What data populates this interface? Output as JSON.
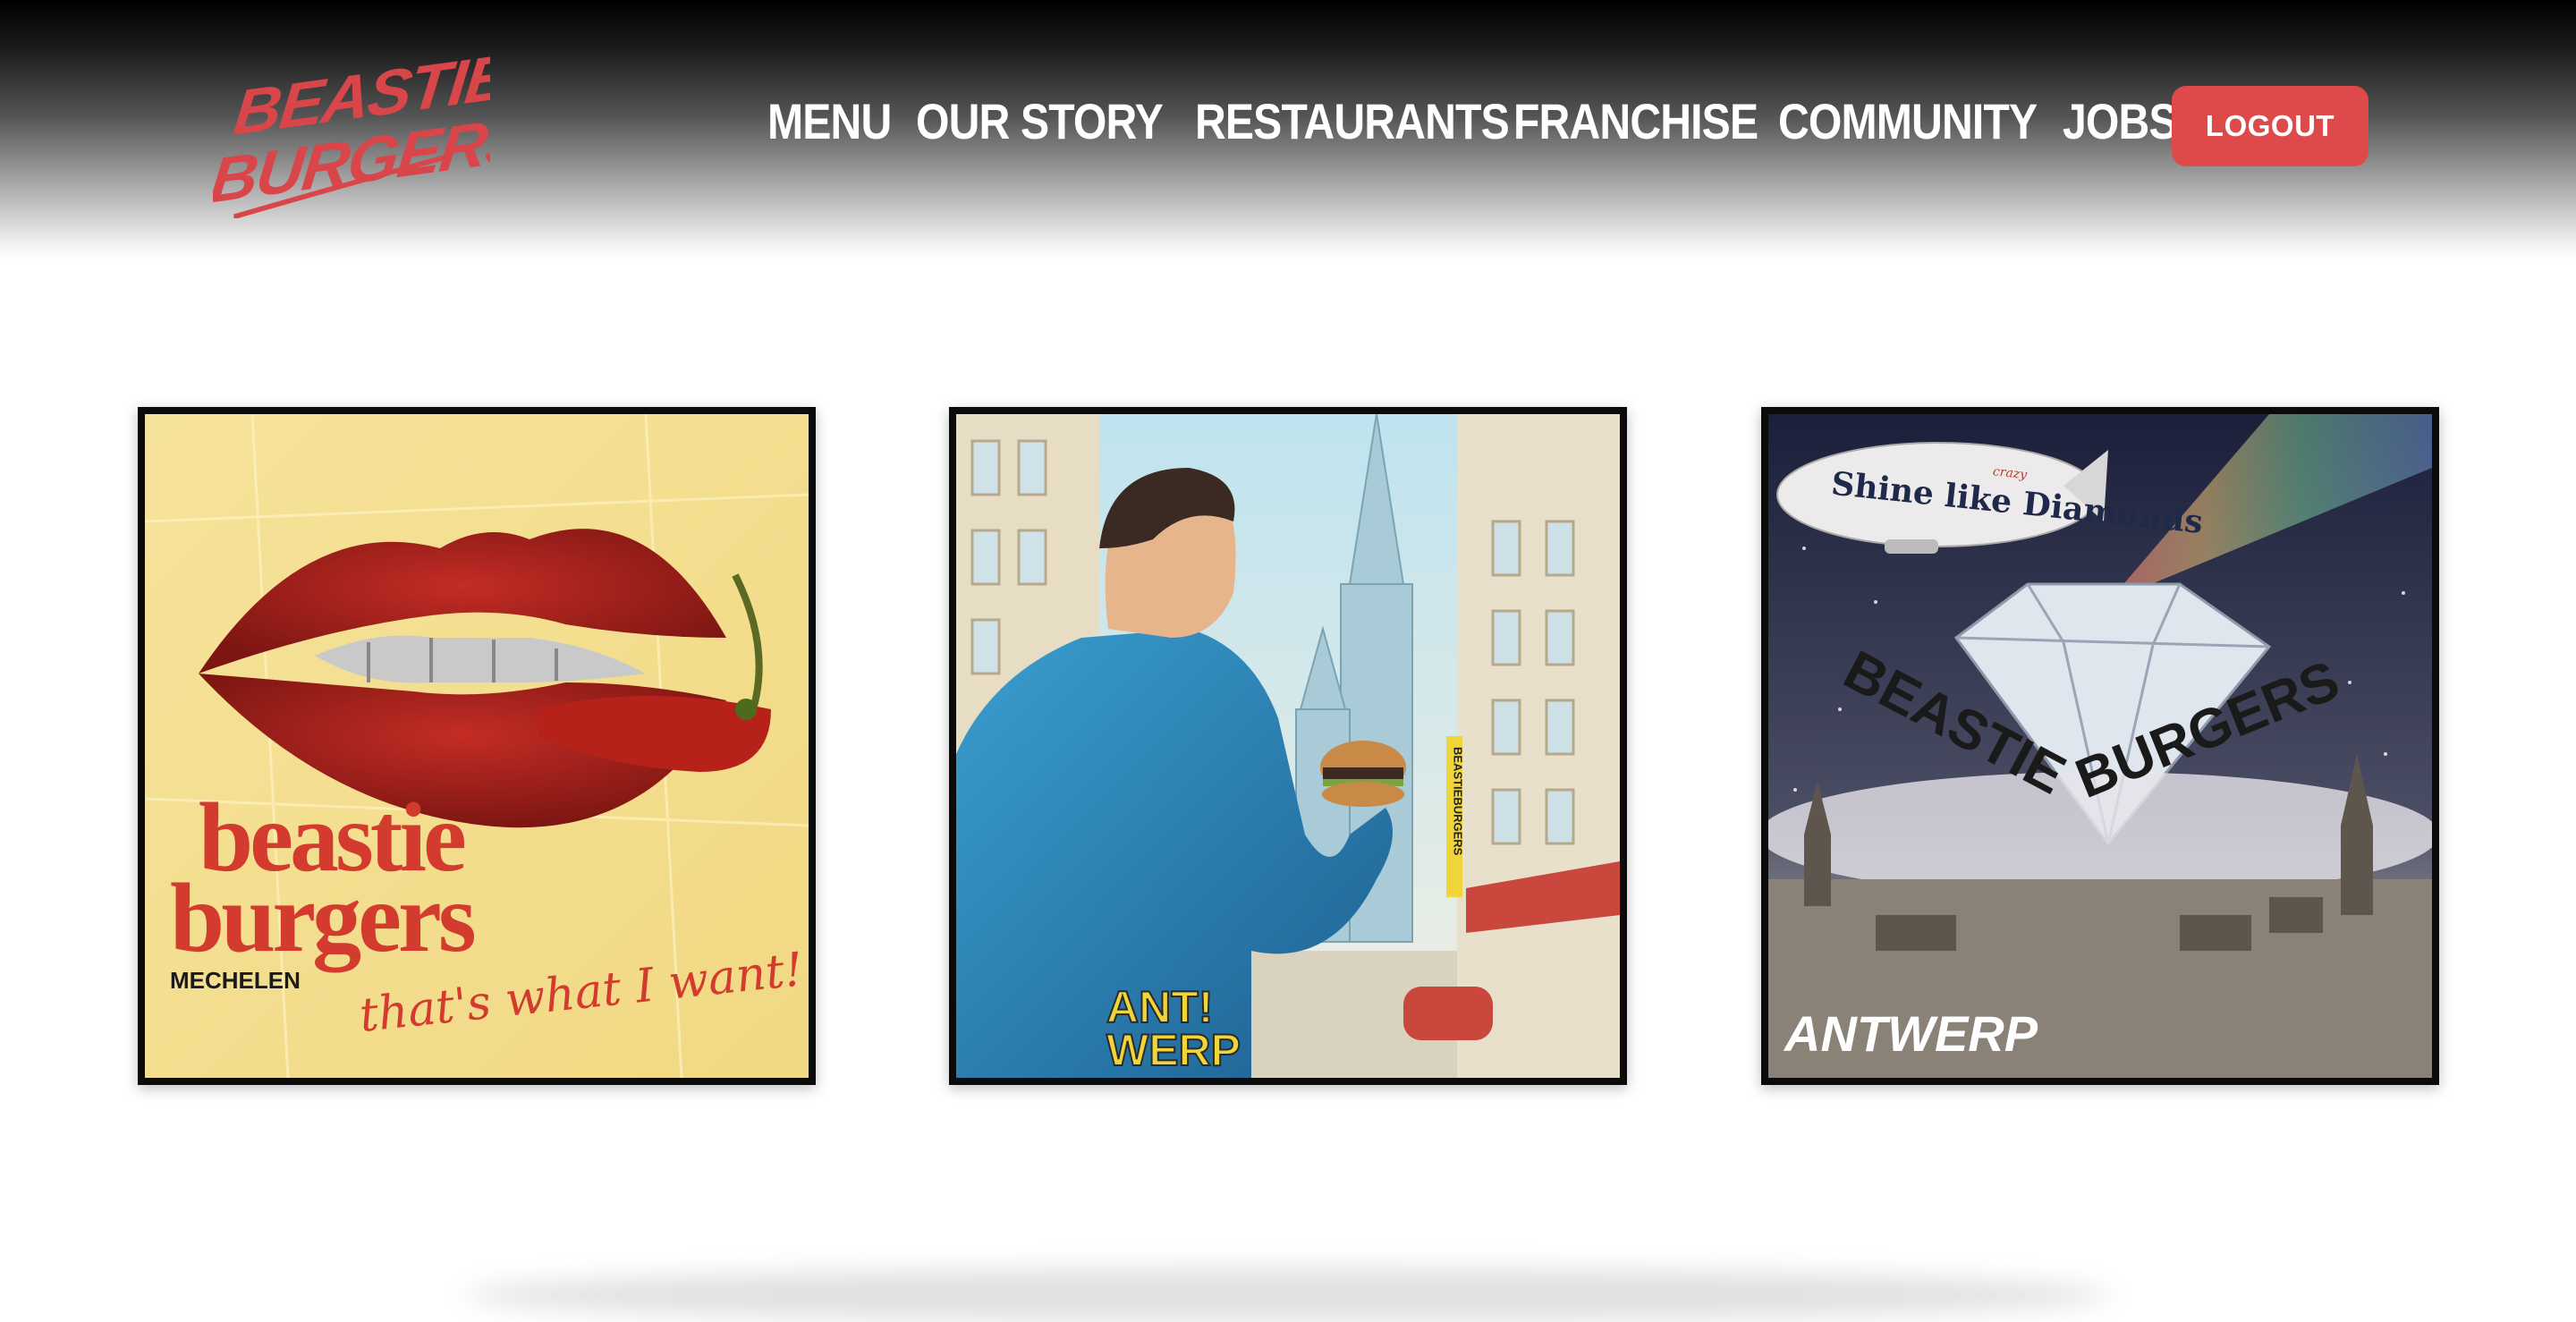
{
  "brand": {
    "line1": "BEASTIE",
    "line2": "BURGERS",
    "color": "#d9464a"
  },
  "nav": {
    "items": [
      {
        "label": "MENU"
      },
      {
        "label": "OUR STORY"
      },
      {
        "label": "RESTAURANTS"
      },
      {
        "label": "FRANCHISE"
      },
      {
        "label": "COMMUNITY"
      },
      {
        "label": "JOBS"
      }
    ],
    "logout_label": "LOGOUT"
  },
  "posters": [
    {
      "line1": "beastie",
      "line2": "burgers",
      "city": "MECHELEN",
      "tagline": "that's what I want!"
    },
    {
      "city_line1": "ANT!",
      "city_line2": "WERP",
      "sign": "BEASTIEBURGERS"
    },
    {
      "blimp": "Shine like Diamonds",
      "blimp_small": "crazy",
      "brand_left": "BEASTIE",
      "brand_right": "BURGERS",
      "city": "ANTWERP"
    }
  ]
}
